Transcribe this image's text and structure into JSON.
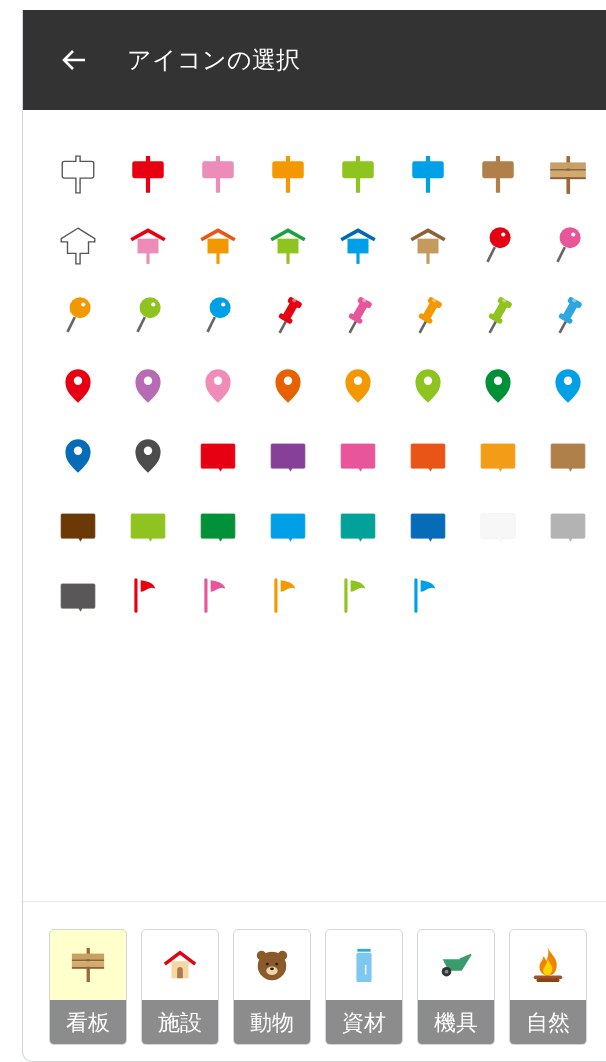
{
  "header": {
    "title": "アイコンの選択"
  },
  "icons": [
    {
      "kind": "sign-outline"
    },
    {
      "kind": "sign",
      "color": "#e60012"
    },
    {
      "kind": "sign",
      "color": "#eb8cb9"
    },
    {
      "kind": "sign",
      "color": "#f39800"
    },
    {
      "kind": "sign",
      "color": "#8fc31f"
    },
    {
      "kind": "sign",
      "color": "#00a0e9"
    },
    {
      "kind": "sign",
      "color": "#b0804a"
    },
    {
      "kind": "sign-wood"
    },
    {
      "kind": "house-outline"
    },
    {
      "kind": "house",
      "color": "#eb8cb9",
      "roof": {
        "color": "#e60012"
      }
    },
    {
      "kind": "house",
      "color": "#f39800",
      "roof": {
        "color": "#ea5514"
      }
    },
    {
      "kind": "house",
      "color": "#8fc31f",
      "roof": {
        "color": "#1ea040"
      }
    },
    {
      "kind": "house",
      "color": "#00a0e9",
      "roof": {
        "color": "#0068b7"
      }
    },
    {
      "kind": "house",
      "color": "#c49a5e",
      "roof": {
        "color": "#8c6239"
      }
    },
    {
      "kind": "pin",
      "color": "#e60012"
    },
    {
      "kind": "pin",
      "color": "#e8559a"
    },
    {
      "kind": "pin",
      "color": "#f39800"
    },
    {
      "kind": "pin",
      "color": "#8fc31f"
    },
    {
      "kind": "pin",
      "color": "#00a0e9"
    },
    {
      "kind": "pushpin",
      "color": "#e60012"
    },
    {
      "kind": "pushpin",
      "color": "#e8559a"
    },
    {
      "kind": "pushpin",
      "color": "#f39800"
    },
    {
      "kind": "pushpin",
      "color": "#8fc31f"
    },
    {
      "kind": "pushpin",
      "color": "#2ea7e0"
    },
    {
      "kind": "marker",
      "color": "#e60012"
    },
    {
      "kind": "marker",
      "color": "#b86bb5"
    },
    {
      "kind": "marker",
      "color": "#f08cb8"
    },
    {
      "kind": "marker",
      "color": "#e86100"
    },
    {
      "kind": "marker",
      "color": "#f39800"
    },
    {
      "kind": "marker",
      "color": "#8fc31f"
    },
    {
      "kind": "marker",
      "color": "#009138"
    },
    {
      "kind": "marker",
      "color": "#00a0e9"
    },
    {
      "kind": "marker",
      "color": "#066cb8"
    },
    {
      "kind": "marker",
      "color": "#4d4d4d"
    },
    {
      "kind": "balloon",
      "color": "#e60012"
    },
    {
      "kind": "balloon",
      "color": "#86409a"
    },
    {
      "kind": "balloon",
      "color": "#e8559a"
    },
    {
      "kind": "balloon",
      "color": "#e95516"
    },
    {
      "kind": "balloon",
      "color": "#f39c17"
    },
    {
      "kind": "balloon",
      "color": "#b0804a"
    },
    {
      "kind": "balloon",
      "color": "#6a3906"
    },
    {
      "kind": "balloon",
      "color": "#8fc31f"
    },
    {
      "kind": "balloon",
      "color": "#009139"
    },
    {
      "kind": "balloon",
      "color": "#00a0e9"
    },
    {
      "kind": "balloon",
      "color": "#00a29a"
    },
    {
      "kind": "balloon",
      "color": "#066cb8"
    },
    {
      "kind": "balloon",
      "color": "#f7f7f7"
    },
    {
      "kind": "balloon",
      "color": "#b3b3b3"
    },
    {
      "kind": "balloon",
      "color": "#595757"
    },
    {
      "kind": "flag",
      "color": "#e60012"
    },
    {
      "kind": "flag",
      "color": "#e8559a"
    },
    {
      "kind": "flag",
      "color": "#f39800"
    },
    {
      "kind": "flag",
      "color": "#8fc31f"
    },
    {
      "kind": "flag",
      "color": "#00a0e9"
    }
  ],
  "categories": [
    {
      "label": "看板",
      "kind": "sign",
      "selected": true
    },
    {
      "label": "施設",
      "kind": "house",
      "selected": false
    },
    {
      "label": "動物",
      "kind": "bear",
      "selected": false
    },
    {
      "label": "資材",
      "kind": "jar",
      "selected": false
    },
    {
      "label": "機具",
      "kind": "wheelbarrow",
      "selected": false
    },
    {
      "label": "自然",
      "kind": "fire",
      "selected": false
    }
  ]
}
